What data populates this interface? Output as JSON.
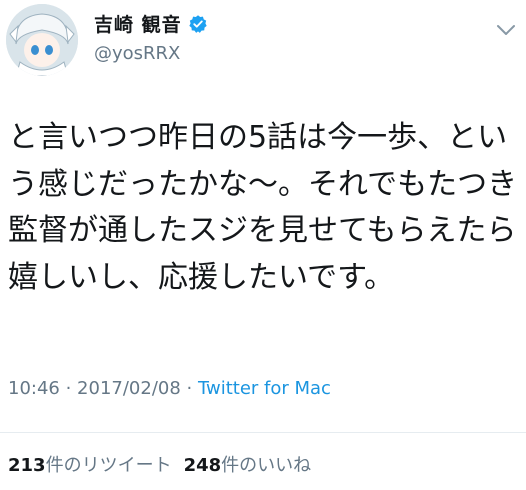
{
  "user": {
    "display_name": "吉崎 観音",
    "handle": "@yosRRX",
    "verified_icon": "verified-badge-icon"
  },
  "tweet": {
    "text": "と言いつつ昨日の5話は今一歩、という感じだったかな〜。それでもたつき監督が通したスジを見せてもらえたら嬉しいし、応援したいです。",
    "time": "10:46",
    "sep1": " · ",
    "date": "2017/02/08",
    "sep2": " · ",
    "source": "Twitter for Mac"
  },
  "stats": {
    "retweet_count": "213",
    "retweet_label": "件のリツイート",
    "like_count": "248",
    "like_label": "件のいいね"
  },
  "colors": {
    "text": "#14171a",
    "secondary": "#657786",
    "link": "#1b95e0",
    "verified": "#1da1f2"
  }
}
